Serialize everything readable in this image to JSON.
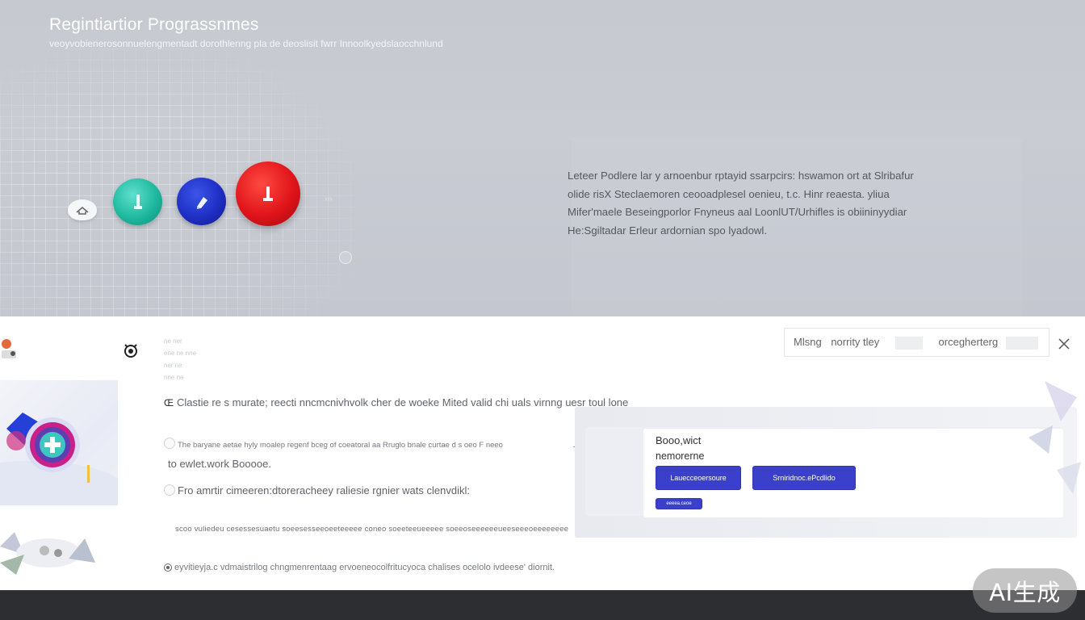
{
  "header": {
    "title": "Regintiartior Prograssnmes",
    "subtitle": "veoyvobienerosonnuelengmentadt dorothlenng pla de deoslisit fwrr Innoolkyedslaocchnlund"
  },
  "steps": [
    {
      "state": "pending",
      "icon": "home-icon",
      "color": "#f6f7f8"
    },
    {
      "state": "complete",
      "icon": "info-icon",
      "color": "#1fb89f"
    },
    {
      "state": "active",
      "icon": "edit-icon",
      "color": "#1f2fc4"
    },
    {
      "state": "error",
      "icon": "alert-icon",
      "color": "#e0141a"
    }
  ],
  "description": [
    "Leteer Podlere lar y arnoenbur rptayid ssarpcirs: hswamon ort at Slribafur",
    "olide risX Steclaemoren ceooadplesel oenieu, t.c. Hinr reaesta. yliua",
    "Mifer'maele Beseingporlor Fnyneus aal LoonlUT/Urhifles is obiininyydiar",
    "He:Sgiltadar Erleur ardornian spo lyadowl."
  ],
  "card": {
    "meta_lines": [
      "ne ner",
      "ene ne nne",
      "ner ne",
      "nne ne"
    ],
    "intro": "Clastie re s murate; reecti nncmcnivhvolk cher de woeke Mited valid chi uals virnng uesr toul lone",
    "option_1": "The baryane aetae hyly moalep regenf bceg of coeatoral aa Rruglo bnale curtae d s oeo F neeo",
    "option_1_cont": "to ewlet.work Booooe.",
    "option_2": "Fro amrtir cimeeren:dtoreracheey raliesie rgnier wats clenvdikl:",
    "option_3": "scoo vuliedeu cesessesuaetu soeesesseeoeeteeeee coneo soeeteeueeeee soeeoseeeeeeueeseeeoeeeeeeee",
    "option_4": "eyvitieyja.c vdmaistrilog chngmenrentaag ervoeneocolfritucyoca chalises ocelolo ivdeese' diornit."
  },
  "search": {
    "placeholder_left": "Mlsng",
    "placeholder_mid": "norrity tley",
    "placeholder_right": "orcegherterg"
  },
  "dialog": {
    "title": "Booo,wict",
    "subtitle": "nemorerne",
    "primary_label": "Lauecceoersoure",
    "secondary_label": "Srniridnoc.ePcdlido",
    "small_label": "eeeea.ceoe"
  },
  "watermark": "AI生成"
}
